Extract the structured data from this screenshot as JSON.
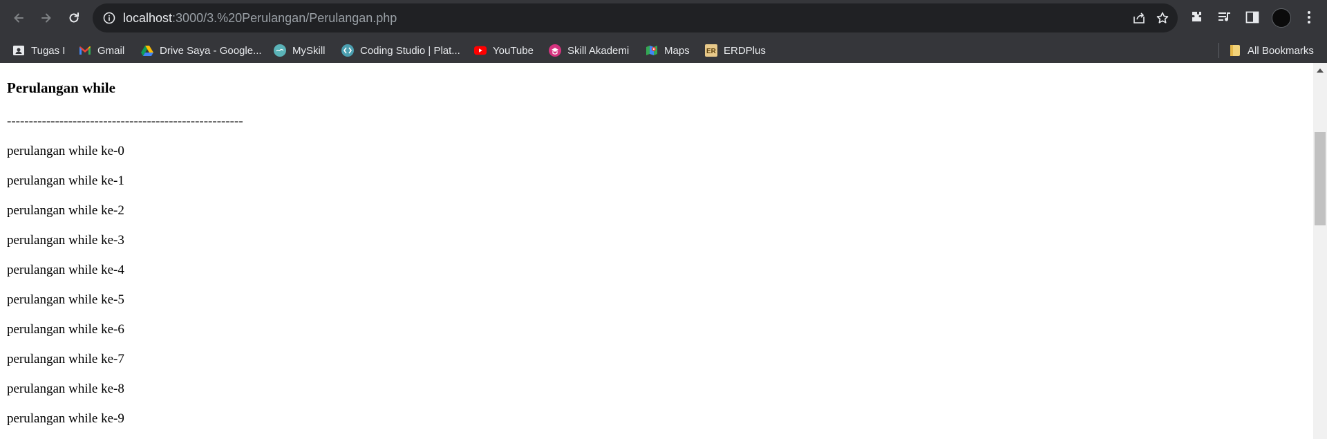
{
  "browser": {
    "url_host": "localhost",
    "url_path": ":3000/3.%20Perulangan/Perulangan.php",
    "bookmarks": [
      {
        "label": "Tugas I",
        "icon": "contact-card-icon"
      },
      {
        "label": "Gmail",
        "icon": "gmail-icon"
      },
      {
        "label": "Drive Saya - Google...",
        "icon": "google-drive-icon"
      },
      {
        "label": "MySkill",
        "icon": "myskill-icon"
      },
      {
        "label": "Coding Studio | Plat...",
        "icon": "coding-studio-icon"
      },
      {
        "label": "YouTube",
        "icon": "youtube-icon"
      },
      {
        "label": "Skill Akademi",
        "icon": "skill-akademi-icon"
      },
      {
        "label": "Maps",
        "icon": "google-maps-icon"
      },
      {
        "label": "ERDPlus",
        "icon": "erdplus-icon"
      }
    ],
    "all_bookmarks_label": "All Bookmarks",
    "colors": {
      "frame": "#35363a",
      "omnibox": "#202124",
      "text": "#e8eaed"
    }
  },
  "page": {
    "heading": "Perulangan while",
    "divider": "------------------------------------------------------",
    "lines": [
      "perulangan while ke-0",
      "perulangan while ke-1",
      "perulangan while ke-2",
      "perulangan while ke-3",
      "perulangan while ke-4",
      "perulangan while ke-5",
      "perulangan while ke-6",
      "perulangan while ke-7",
      "perulangan while ke-8",
      "perulangan while ke-9"
    ]
  }
}
